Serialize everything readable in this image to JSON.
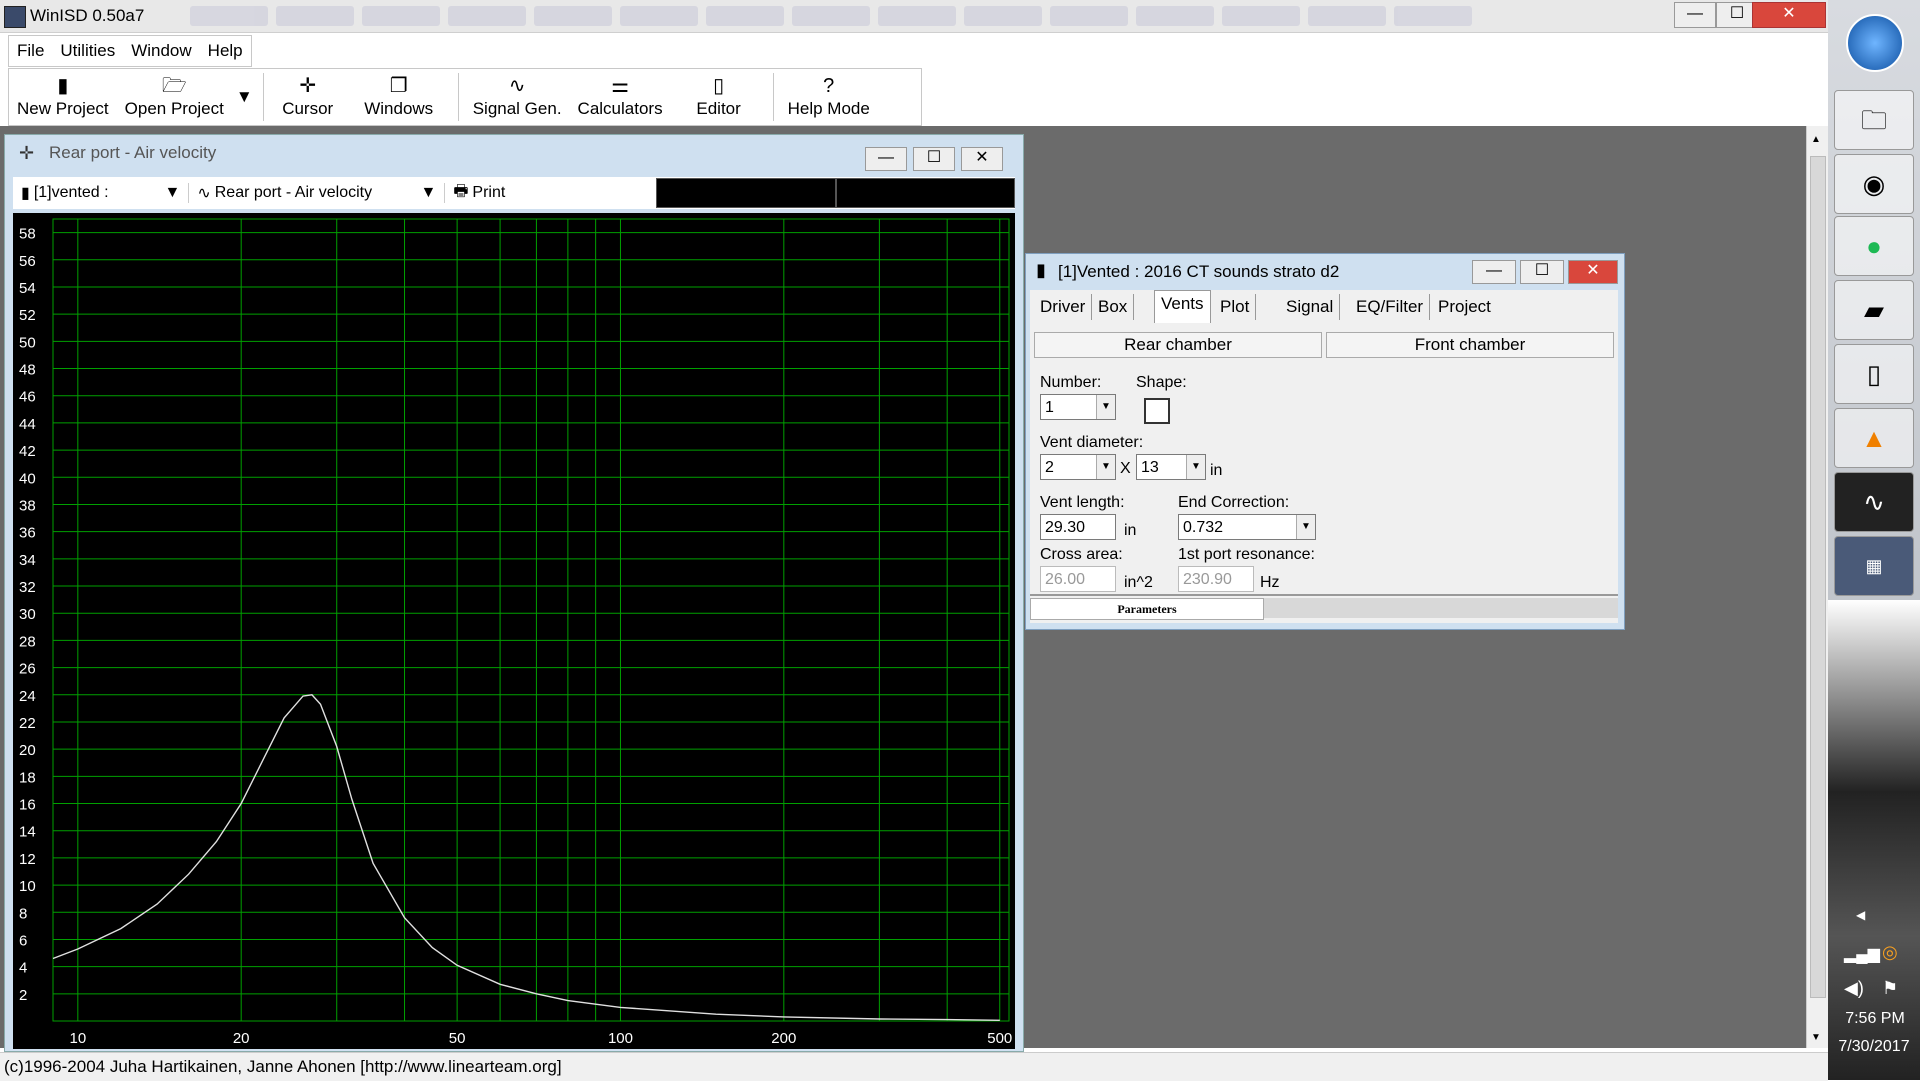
{
  "app": {
    "title": "WinISD 0.50a7"
  },
  "window_controls": {
    "minimize": "—",
    "maximize": "☐",
    "close": "✕"
  },
  "menu": [
    {
      "label": "File"
    },
    {
      "label": "Utilities"
    },
    {
      "label": "Window"
    },
    {
      "label": "Help"
    }
  ],
  "toolbar": {
    "new_project": "New Project",
    "open_project": "Open Project",
    "cursor": "Cursor",
    "windows": "Windows",
    "signal_gen": "Signal Gen.",
    "calculators": "Calculators",
    "editor": "Editor",
    "help_mode": "Help Mode"
  },
  "graph_window": {
    "title": "Rear port - Air velocity",
    "project_selector": "[1]vented :",
    "graph_selector": "Rear port - Air velocity",
    "print_label": "Print"
  },
  "params_window": {
    "title": "[1]Vented : 2016 CT sounds strato d2",
    "tabs": [
      "Driver",
      "Box",
      "Vents",
      "Plot",
      "Signal",
      "EQ/Filter",
      "Project"
    ],
    "active_tab": "Vents",
    "rear_chamber": "Rear chamber",
    "front_chamber": "Front chamber",
    "number_label": "Number:",
    "number_value": "1",
    "shape_label": "Shape:",
    "vent_diameter_label": "Vent diameter:",
    "vent_diameter_a": "2",
    "vent_diameter_x": "X",
    "vent_diameter_b": "13",
    "vent_diameter_unit": "in",
    "vent_length_label": "Vent length:",
    "vent_length_value": "29.30",
    "vent_length_unit": "in",
    "end_correction_label": "End Correction:",
    "end_correction_value": "0.732",
    "cross_area_label": "Cross area:",
    "cross_area_value": "26.00",
    "cross_area_unit": "in^2",
    "port_res_label": "1st port resonance:",
    "port_res_value": "230.90",
    "port_res_unit": "Hz",
    "bottom_tab": "Parameters"
  },
  "status": {
    "text": "(c)1996-2004 Juha Hartikainen, Janne Ahonen [http://www.linearteam.org]"
  },
  "taskbar": {
    "time": "7:56 PM",
    "date": "7/30/2017"
  },
  "chart_data": {
    "type": "line",
    "title": "",
    "xlabel": "",
    "ylabel": "",
    "x_scale": "log",
    "xlim": [
      9,
      520
    ],
    "ylim": [
      0,
      59
    ],
    "x_ticks": [
      10,
      20,
      50,
      100,
      200,
      500
    ],
    "y_ticks": [
      2,
      4,
      6,
      8,
      10,
      12,
      14,
      16,
      18,
      20,
      22,
      24,
      26,
      28,
      30,
      32,
      34,
      36,
      38,
      40,
      42,
      44,
      46,
      48,
      50,
      52,
      54,
      56,
      58
    ],
    "grid": true,
    "colors": {
      "background": "#000000",
      "grid": "#00a000",
      "line": "#e0e0e0"
    },
    "series": [
      {
        "x": [
          9,
          10,
          12,
          14,
          16,
          18,
          20,
          22,
          24,
          26,
          27,
          28,
          30,
          32,
          35,
          40,
          45,
          50,
          60,
          70,
          80,
          100,
          150,
          200,
          300,
          400,
          500
        ],
        "y": [
          4.6,
          5.3,
          6.8,
          8.6,
          10.8,
          13.2,
          16.0,
          19.3,
          22.3,
          23.9,
          24.0,
          23.3,
          20.2,
          16.3,
          11.6,
          7.6,
          5.4,
          4.1,
          2.7,
          2.0,
          1.5,
          1.0,
          0.5,
          0.3,
          0.15,
          0.1,
          0.05
        ]
      }
    ]
  }
}
